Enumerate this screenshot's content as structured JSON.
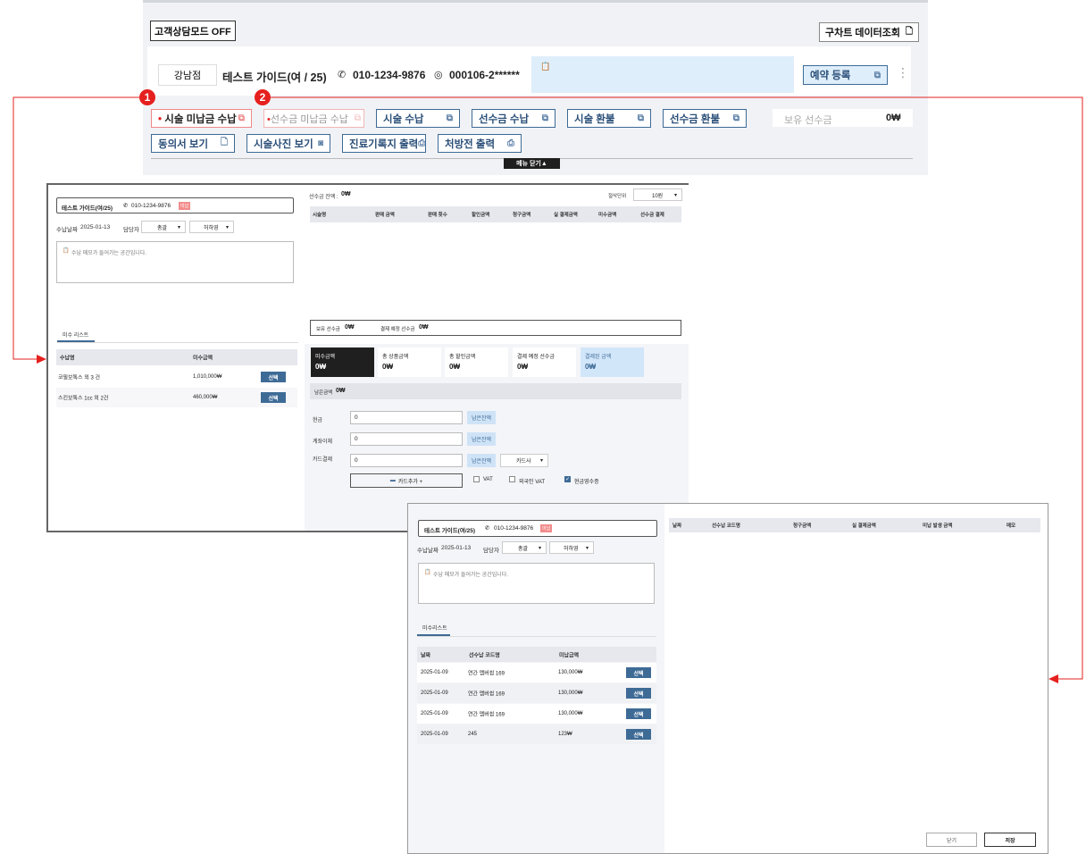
{
  "topbar": {
    "consult_mode": "고객상담모드 OFF",
    "old_chart": "구차트 데이터조회",
    "branch": "강남점",
    "customer": "테스트 가이드(여 / 25)",
    "phone": "010-1234-9876",
    "rrn": "000106-2******",
    "reserve": "예약 등록",
    "row1": [
      "시술 미납금 수납",
      "선수금 미납금 수납",
      "시술 수납",
      "선수금 수납",
      "시술 환불",
      "선수금 환불"
    ],
    "held_label": "보유 선수금",
    "held_value": "0₩",
    "row2": [
      "동의서 보기",
      "시술사진 보기",
      "진료기록지 출력",
      "처방전 출력"
    ],
    "menu_close": "메뉴 닫기▲",
    "badge1": "1",
    "badge2": "2"
  },
  "p1": {
    "customer": "테스트 가이드(여/25)",
    "phone": "010-1234-9876",
    "tag": "미납",
    "date_label": "수납날짜",
    "date": "2025-01-13",
    "manager_label": "담당자",
    "manager1": "총괄",
    "manager2": "허하영",
    "memo": "수납 메모가 들어가는 공간입니다.",
    "tab": "미수 리스트",
    "cols": [
      "수납명",
      "미수금액"
    ],
    "rows": [
      {
        "name": "코필보톡스 외 3 건",
        "amount": "1,010,000₩",
        "btn": "선택"
      },
      {
        "name": "스킨보톡스 1cc 외 2건",
        "amount": "460,000₩",
        "btn": "선택"
      }
    ],
    "balance_label": "선수금 잔액 :",
    "balance": "0₩",
    "unit_label": "절삭단위",
    "unit": "10원",
    "table_cols": [
      "시술명",
      "판매 금액",
      "판매 횟수",
      "할인금액",
      "청구금액",
      "실 결제금액",
      "미수금액",
      "선수금 결제"
    ],
    "held_label": "보유 선수금",
    "held": "0₩",
    "planned_label": "결제 예정 선수금",
    "planned": "0₩",
    "sums": [
      {
        "label": "미수금액",
        "value": "0₩"
      },
      {
        "label": "총 상품금액",
        "value": "0₩"
      },
      {
        "label": "총 할인금액",
        "value": "0₩"
      },
      {
        "label": "결제 예정 선수금",
        "value": "0₩"
      },
      {
        "label": "결제된 금액",
        "value": "0₩"
      }
    ],
    "remain_label": "남은금액",
    "remain": "0₩",
    "pay": [
      {
        "label": "현금",
        "value": "0",
        "btn": "남은잔액"
      },
      {
        "label": "계좌이체",
        "value": "0",
        "btn": "남은잔액"
      },
      {
        "label": "카드결제",
        "value": "0",
        "btn": "남은잔액"
      }
    ],
    "card_co": "카드사",
    "add_card": "카드추가 +",
    "vat": "VAT",
    "foreign_vat": "외국인 VAT",
    "cash_receipt": "현금영수증"
  },
  "p2": {
    "customer": "테스트 가이드(여/25)",
    "phone": "010-1234-9876",
    "tag": "미납",
    "date_label": "수납날짜",
    "date": "2025-01-13",
    "manager_label": "담당자",
    "manager1": "총괄",
    "manager2": "허하영",
    "memo": "수납 메모가 들어가는 공간입니다.",
    "tab": "미수리스트",
    "cols": [
      "날짜",
      "선수납 코드명",
      "미납금액"
    ],
    "rows": [
      {
        "date": "2025-01-09",
        "name": "연간 멤버쉽 169",
        "amount": "130,000₩",
        "btn": "선택"
      },
      {
        "date": "2025-01-09",
        "name": "연간 멤버쉽 169",
        "amount": "130,000₩",
        "btn": "선택"
      },
      {
        "date": "2025-01-09",
        "name": "연간 멤버쉽 169",
        "amount": "130,000₩",
        "btn": "선택"
      },
      {
        "date": "2025-01-09",
        "name": "245",
        "amount": "123₩",
        "btn": "선택"
      }
    ],
    "right_cols": [
      "날짜",
      "선수납 코드명",
      "청구금액",
      "실 결제금액",
      "미납 발생 금액",
      "메모"
    ],
    "close": "닫기",
    "save": "저장"
  },
  "colors": {
    "accent": "#3e6b96",
    "badge": "#e5201e",
    "dark": "#1f1f1f"
  }
}
